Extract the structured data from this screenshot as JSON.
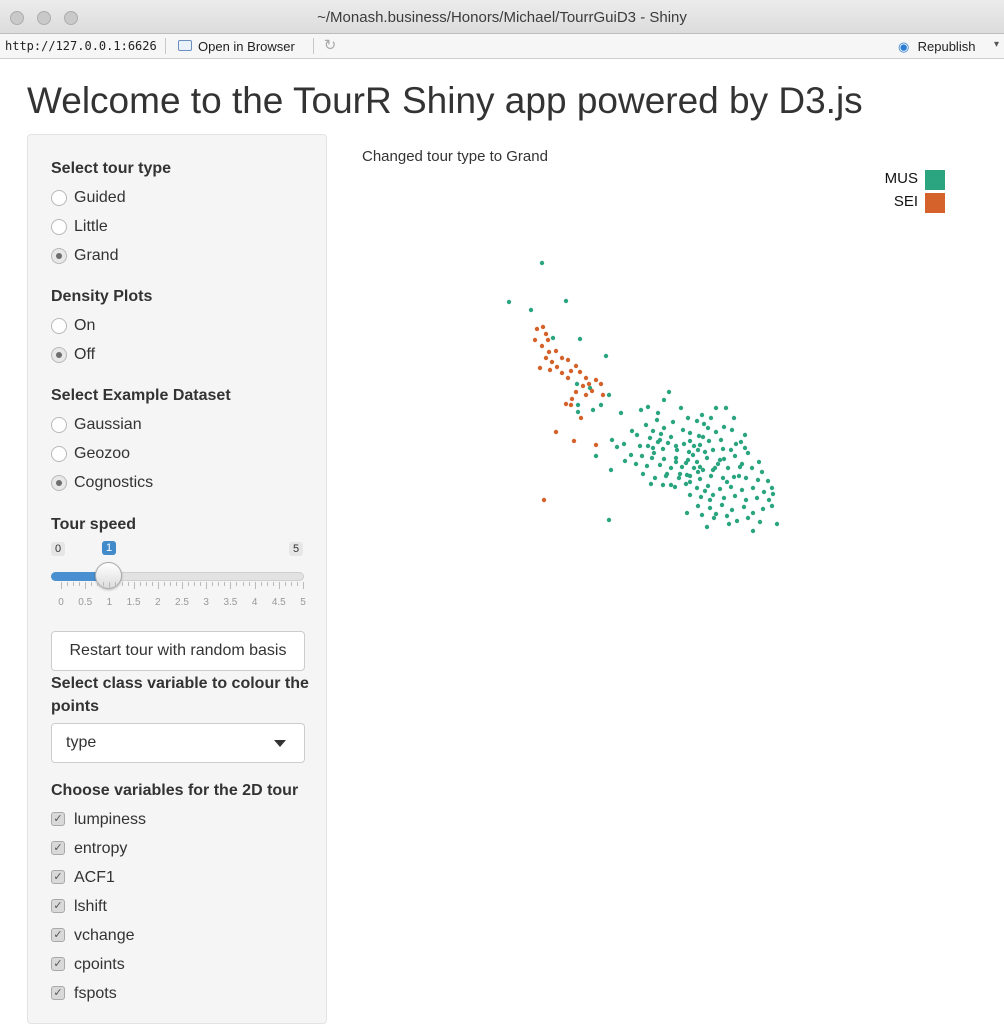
{
  "window": {
    "title": "~/Monash.business/Honors/Michael/TourrGuiD3 - Shiny"
  },
  "toolbar": {
    "url": "http://127.0.0.1:6626",
    "open_in_browser": "Open in Browser",
    "republish": "Republish"
  },
  "page": {
    "title": "Welcome to the TourR Shiny app powered by D3.js"
  },
  "sidebar": {
    "tour_type": {
      "label": "Select tour type",
      "options": [
        "Guided",
        "Little",
        "Grand"
      ],
      "selected": "Grand"
    },
    "density": {
      "label": "Density Plots",
      "options": [
        "On",
        "Off"
      ],
      "selected": "Off"
    },
    "dataset": {
      "label": "Select Example Dataset",
      "options": [
        "Gaussian",
        "Geozoo",
        "Cognostics"
      ],
      "selected": "Cognostics"
    },
    "speed": {
      "label": "Tour speed",
      "min": "0",
      "max": "5",
      "value": "1",
      "value_number": 1,
      "ticks": [
        "0",
        "0.5",
        "1",
        "1.5",
        "2",
        "2.5",
        "3",
        "3.5",
        "4",
        "4.5",
        "5"
      ]
    },
    "restart_button": "Restart tour with random basis",
    "class_var": {
      "label": "Select class variable to colour the points",
      "selected": "type"
    },
    "variables": {
      "label": "Choose variables for the 2D tour",
      "items": [
        "lumpiness",
        "entropy",
        "ACF1",
        "lshift",
        "vchange",
        "cpoints",
        "fspots"
      ],
      "checked": [
        true,
        true,
        true,
        true,
        true,
        true,
        true
      ]
    }
  },
  "plot": {
    "status": "Changed tour type to Grand"
  },
  "chart_data": {
    "type": "scatter",
    "title": "",
    "xlabel": "",
    "ylabel": "",
    "grid": false,
    "legend": "top-right",
    "series": [
      {
        "name": "MUS",
        "color": "#2aa57f",
        "points": [
          [
            542,
            263
          ],
          [
            509,
            302
          ],
          [
            531,
            310
          ],
          [
            566,
            301
          ],
          [
            553,
            338
          ],
          [
            580,
            339
          ],
          [
            606,
            356
          ],
          [
            577,
            384
          ],
          [
            590,
            388
          ],
          [
            601,
            405
          ],
          [
            609,
            395
          ],
          [
            593,
            410
          ],
          [
            578,
            412
          ],
          [
            578,
            405
          ],
          [
            669,
            392
          ],
          [
            664,
            400
          ],
          [
            681,
            408
          ],
          [
            716,
            408
          ],
          [
            726,
            408
          ],
          [
            621,
            413
          ],
          [
            641,
            410
          ],
          [
            648,
            407
          ],
          [
            658,
            413
          ],
          [
            688,
            418
          ],
          [
            702,
            415
          ],
          [
            734,
            418
          ],
          [
            646,
            425
          ],
          [
            657,
            420
          ],
          [
            673,
            422
          ],
          [
            697,
            421
          ],
          [
            704,
            424
          ],
          [
            711,
            418
          ],
          [
            724,
            427
          ],
          [
            632,
            431
          ],
          [
            653,
            431
          ],
          [
            664,
            428
          ],
          [
            683,
            430
          ],
          [
            690,
            433
          ],
          [
            716,
            432
          ],
          [
            732,
            430
          ],
          [
            745,
            435
          ],
          [
            650,
            438
          ],
          [
            660,
            440
          ],
          [
            668,
            443
          ],
          [
            690,
            441
          ],
          [
            700,
            445
          ],
          [
            709,
            441
          ],
          [
            721,
            440
          ],
          [
            741,
            442
          ],
          [
            624,
            444
          ],
          [
            640,
            446
          ],
          [
            653,
            448
          ],
          [
            663,
            449
          ],
          [
            677,
            450
          ],
          [
            689,
            452
          ],
          [
            698,
            450
          ],
          [
            713,
            450
          ],
          [
            723,
            449
          ],
          [
            745,
            448
          ],
          [
            617,
            447
          ],
          [
            612,
            440
          ],
          [
            631,
            455
          ],
          [
            642,
            456
          ],
          [
            652,
            458
          ],
          [
            664,
            459
          ],
          [
            676,
            458
          ],
          [
            688,
            460
          ],
          [
            697,
            462
          ],
          [
            707,
            458
          ],
          [
            720,
            460
          ],
          [
            735,
            456
          ],
          [
            748,
            453
          ],
          [
            759,
            462
          ],
          [
            596,
            456
          ],
          [
            625,
            461
          ],
          [
            636,
            464
          ],
          [
            647,
            466
          ],
          [
            660,
            465
          ],
          [
            671,
            468
          ],
          [
            682,
            467
          ],
          [
            694,
            468
          ],
          [
            703,
            470
          ],
          [
            715,
            468
          ],
          [
            728,
            468
          ],
          [
            740,
            467
          ],
          [
            752,
            468
          ],
          [
            762,
            472
          ],
          [
            611,
            470
          ],
          [
            643,
            474
          ],
          [
            655,
            478
          ],
          [
            667,
            474
          ],
          [
            679,
            478
          ],
          [
            690,
            476
          ],
          [
            700,
            479
          ],
          [
            711,
            476
          ],
          [
            723,
            478
          ],
          [
            734,
            477
          ],
          [
            746,
            478
          ],
          [
            758,
            480
          ],
          [
            768,
            481
          ],
          [
            651,
            484
          ],
          [
            663,
            485
          ],
          [
            675,
            487
          ],
          [
            686,
            484
          ],
          [
            697,
            488
          ],
          [
            708,
            486
          ],
          [
            720,
            489
          ],
          [
            731,
            487
          ],
          [
            742,
            490
          ],
          [
            753,
            488
          ],
          [
            764,
            492
          ],
          [
            772,
            488
          ],
          [
            690,
            495
          ],
          [
            701,
            497
          ],
          [
            713,
            495
          ],
          [
            724,
            498
          ],
          [
            735,
            496
          ],
          [
            746,
            500
          ],
          [
            757,
            498
          ],
          [
            769,
            500
          ],
          [
            773,
            494
          ],
          [
            698,
            506
          ],
          [
            710,
            508
          ],
          [
            722,
            505
          ],
          [
            732,
            510
          ],
          [
            744,
            507
          ],
          [
            753,
            513
          ],
          [
            763,
            509
          ],
          [
            772,
            506
          ],
          [
            609,
            520
          ],
          [
            702,
            515
          ],
          [
            714,
            518
          ],
          [
            727,
            516
          ],
          [
            737,
            521
          ],
          [
            748,
            518
          ],
          [
            760,
            522
          ],
          [
            777,
            524
          ],
          [
            707,
            527
          ],
          [
            729,
            524
          ],
          [
            753,
            531
          ],
          [
            687,
            513
          ],
          [
            680,
            474
          ],
          [
            658,
            442
          ],
          [
            700,
            467
          ],
          [
            693,
            455
          ],
          [
            686,
            463
          ],
          [
            705,
            452
          ],
          [
            699,
            436
          ],
          [
            661,
            434
          ],
          [
            671,
            437
          ],
          [
            718,
            464
          ],
          [
            727,
            482
          ],
          [
            739,
            476
          ],
          [
            710,
            500
          ],
          [
            666,
            476
          ],
          [
            676,
            446
          ],
          [
            690,
            482
          ],
          [
            705,
            491
          ],
          [
            716,
            514
          ],
          [
            742,
            464
          ],
          [
            731,
            450
          ],
          [
            648,
            446
          ],
          [
            637,
            435
          ],
          [
            654,
            453
          ],
          [
            684,
            444
          ],
          [
            698,
            472
          ],
          [
            676,
            462
          ],
          [
            713,
            470
          ],
          [
            724,
            459
          ],
          [
            736,
            444
          ],
          [
            703,
            437
          ],
          [
            708,
            428
          ],
          [
            694,
            446
          ],
          [
            687,
            475
          ],
          [
            671,
            485
          ]
        ]
      },
      {
        "name": "SEI",
        "color": "#d4622a",
        "points": [
          [
            537,
            329
          ],
          [
            543,
            327
          ],
          [
            546,
            334
          ],
          [
            535,
            340
          ],
          [
            548,
            340
          ],
          [
            542,
            346
          ],
          [
            549,
            352
          ],
          [
            556,
            351
          ],
          [
            546,
            358
          ],
          [
            552,
            362
          ],
          [
            562,
            358
          ],
          [
            568,
            360
          ],
          [
            557,
            367
          ],
          [
            550,
            370
          ],
          [
            540,
            368
          ],
          [
            562,
            373
          ],
          [
            571,
            371
          ],
          [
            568,
            378
          ],
          [
            576,
            366
          ],
          [
            580,
            372
          ],
          [
            586,
            378
          ],
          [
            589,
            384
          ],
          [
            596,
            380
          ],
          [
            601,
            384
          ],
          [
            583,
            386
          ],
          [
            576,
            392
          ],
          [
            592,
            391
          ],
          [
            586,
            395
          ],
          [
            603,
            395
          ],
          [
            572,
            399
          ],
          [
            566,
            404
          ],
          [
            571,
            405
          ],
          [
            556,
            432
          ],
          [
            574,
            441
          ],
          [
            596,
            445
          ],
          [
            544,
            500
          ],
          [
            581,
            418
          ]
        ]
      }
    ]
  }
}
